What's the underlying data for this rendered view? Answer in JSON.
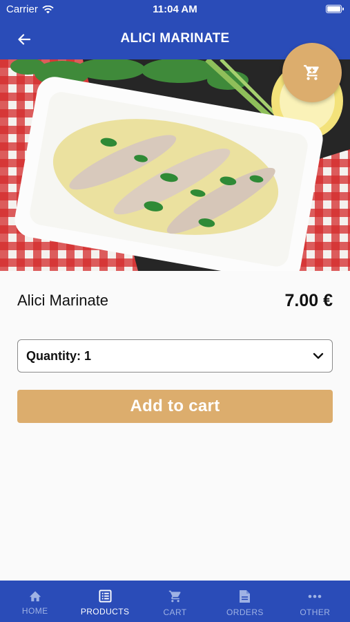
{
  "status_bar": {
    "carrier": "Carrier",
    "time": "11:04 AM"
  },
  "header": {
    "title": "ALICI MARINATE",
    "back_icon": "back-arrow-icon"
  },
  "cart_fab": {
    "icon": "shopping-cart-icon"
  },
  "product": {
    "name": "Alici Marinate",
    "price": "7.00 €"
  },
  "quantity_select": {
    "selected": "Quantity: 1",
    "icon": "chevron-down-icon"
  },
  "add_to_cart": {
    "label": "Add to cart"
  },
  "tabbar": {
    "items": [
      {
        "label": "HOME",
        "icon": "home-icon",
        "active": false
      },
      {
        "label": "PRODUCTS",
        "icon": "list-icon",
        "active": true
      },
      {
        "label": "CART",
        "icon": "cart-icon",
        "active": false
      },
      {
        "label": "ORDERS",
        "icon": "document-icon",
        "active": false
      },
      {
        "label": "OTHER",
        "icon": "more-icon",
        "active": false
      }
    ]
  },
  "colors": {
    "brand_blue": "#2a4cb8",
    "accent_gold": "#dcad6d",
    "tab_inactive": "#9fb2e4"
  }
}
